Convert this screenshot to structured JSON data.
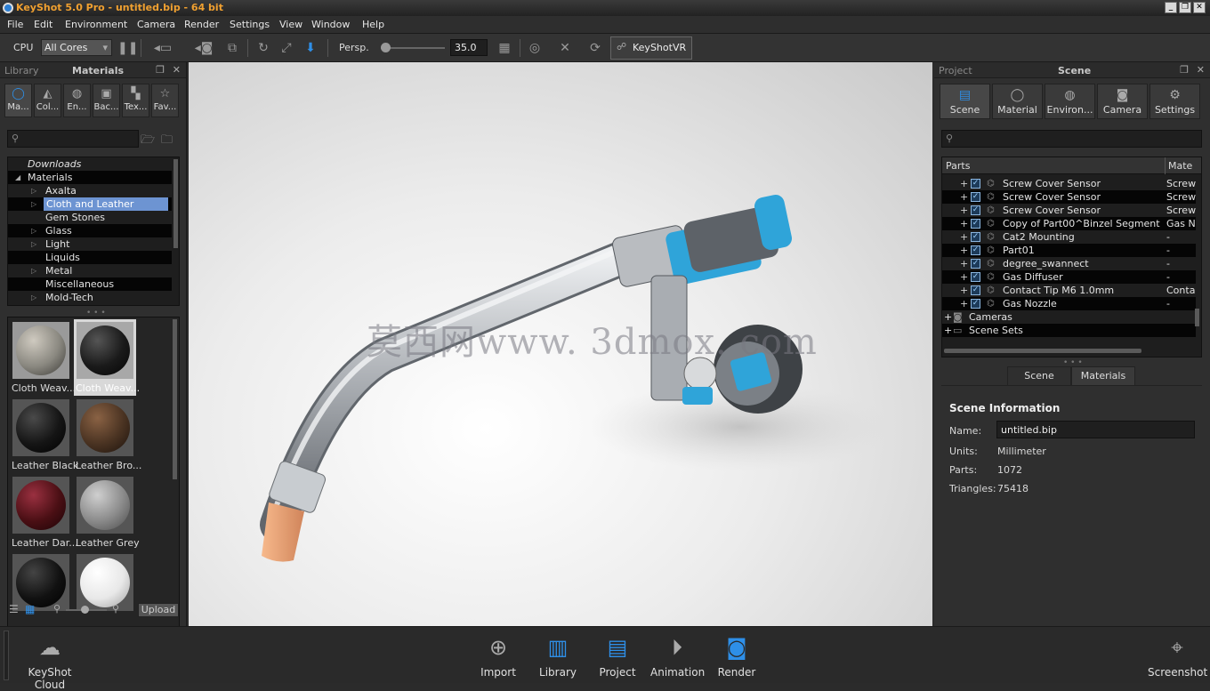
{
  "window": {
    "title": "KeyShot 5.0 Pro  - untitled.bip  - 64 bit"
  },
  "menu": [
    "File",
    "Edit",
    "Environment",
    "Camera",
    "Render",
    "Settings",
    "View",
    "Window",
    "Help"
  ],
  "toolbar": {
    "cpu_label": "CPU",
    "cores_value": "All Cores",
    "projection": "Persp.",
    "fov_value": "35.0",
    "vr_label": "KeyShotVR"
  },
  "library": {
    "panel_title": "Library",
    "active_tab": "Materials",
    "tabs": [
      "Ma...",
      "Col...",
      "En...",
      "Bac...",
      "Tex...",
      "Fav..."
    ],
    "tree": [
      "Downloads",
      "Materials",
      "Axalta",
      "Cloth and Leather",
      "Gem Stones",
      "Glass",
      "Light",
      "Liquids",
      "Metal",
      "Miscellaneous",
      "Mold-Tech"
    ],
    "thumbs": [
      {
        "label": "Cloth Weav...",
        "color": "#8a8880"
      },
      {
        "label": "Cloth Weav...",
        "color": "#1a1a1a"
      },
      {
        "label": "Leather Black",
        "color": "#151515"
      },
      {
        "label": "Leather Bro...",
        "color": "#4a3322"
      },
      {
        "label": "Leather Dar...",
        "color": "#4a0f14"
      },
      {
        "label": "Leather Grey",
        "color": "#8a8a8a"
      },
      {
        "label": "",
        "color": "#111"
      },
      {
        "label": "",
        "color": "#e8e8e8"
      }
    ],
    "upload_label": "Upload"
  },
  "viewport": {
    "watermark": "莫西网www. 3dmox. com"
  },
  "project": {
    "panel_title": "Project",
    "active_tab": "Scene",
    "tabs": [
      "Scene",
      "Material",
      "Environ...",
      "Camera",
      "Settings"
    ],
    "col_parts": "Parts",
    "col_material": "Mate",
    "rows": [
      {
        "name": "Screw Cover Sensor",
        "mat": "Screw"
      },
      {
        "name": "Screw Cover Sensor",
        "mat": "Screw"
      },
      {
        "name": "Screw Cover Sensor",
        "mat": "Screw"
      },
      {
        "name": "Copy of Part00^Binzel Segment ...",
        "mat": "Gas N"
      },
      {
        "name": "Cat2 Mounting",
        "mat": "-"
      },
      {
        "name": "Part01",
        "mat": "-"
      },
      {
        "name": "degree_swannect",
        "mat": "-"
      },
      {
        "name": "Gas Diffuser",
        "mat": "-"
      },
      {
        "name": "Contact Tip M6 1.0mm",
        "mat": "Conta"
      },
      {
        "name": "Gas Nozzle",
        "mat": "-"
      }
    ],
    "cameras": "Cameras",
    "scene_sets": "Scene Sets",
    "subtabs": [
      "Scene",
      "Materials"
    ],
    "info_title": "Scene Information",
    "name_label": "Name:",
    "name_value": "untitled.bip",
    "units_label": "Units:",
    "units_value": "Millimeter",
    "parts_label": "Parts:",
    "parts_value": "1072",
    "tri_label": "Triangles:",
    "tri_value": "75418"
  },
  "bottom": {
    "cloud": "KeyShot Cloud",
    "import": "Import",
    "library": "Library",
    "project": "Project",
    "animation": "Animation",
    "render": "Render",
    "screenshot": "Screenshot"
  }
}
